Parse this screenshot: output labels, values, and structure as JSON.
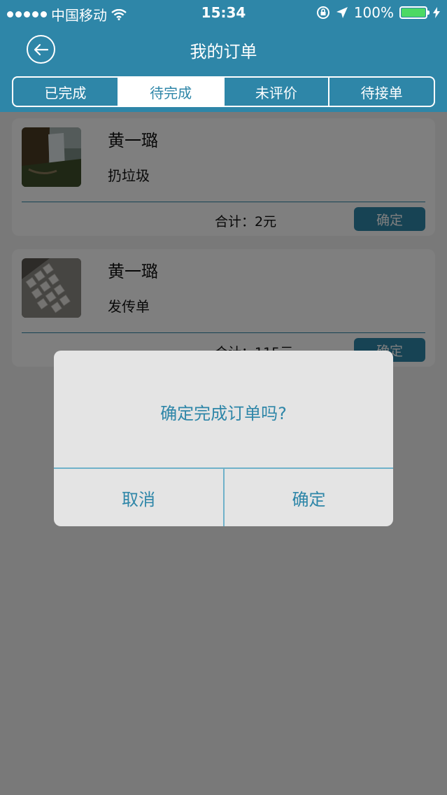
{
  "status_bar": {
    "carrier": "中国移动",
    "time": "15:34",
    "battery": "100%",
    "battery_level": 1.0
  },
  "nav": {
    "title": "我的订单"
  },
  "tabs": [
    {
      "label": "已完成",
      "active": false
    },
    {
      "label": "待完成",
      "active": true
    },
    {
      "label": "未评价",
      "active": false
    },
    {
      "label": "待接单",
      "active": false
    }
  ],
  "orders": [
    {
      "name": "黄一璐",
      "service": "扔垃圾",
      "total": "合计：2元",
      "button": "确定",
      "thumbnail": "waterfall-photo"
    },
    {
      "name": "黄一璐",
      "service": "发传单",
      "total": "合计：115元",
      "button": "确定",
      "thumbnail": "keyboard-photo"
    }
  ],
  "dialog": {
    "message": "确定完成订单吗?",
    "cancel": "取消",
    "confirm": "确定"
  },
  "colors": {
    "primary": "#2e86a8",
    "battery": "#4cd964"
  }
}
